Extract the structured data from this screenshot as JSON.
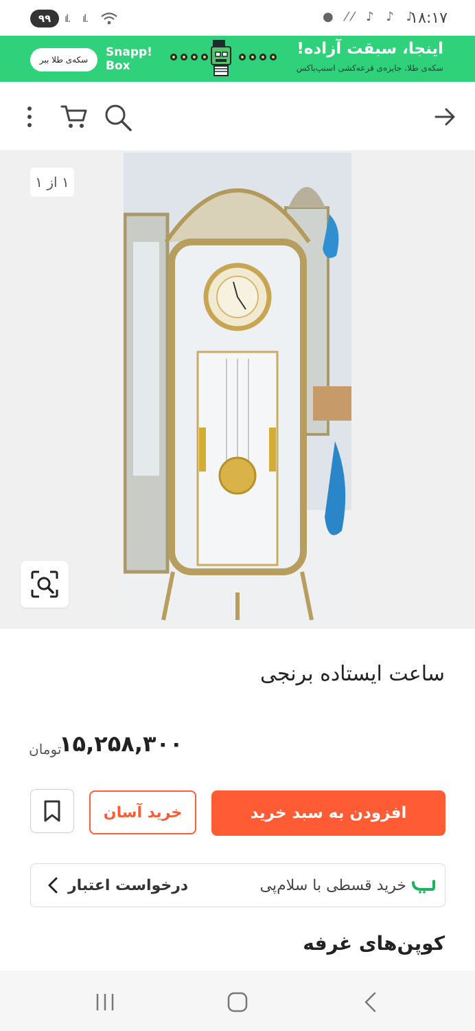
{
  "status_bar": {
    "battery": "۹۹",
    "time": "۱۸:۱۷"
  },
  "banner": {
    "button_label": "سکه‌ی طلا ببر",
    "brand_line1": "Snapp!",
    "brand_line2": "Box",
    "title": "اینجا، سبقت آزاده!",
    "subtitle": "سکه‌ی طلا، جایزه‌ی قرعه‌کشی اسنپ‌باکس",
    "colors": {
      "background": "#2fd17b"
    }
  },
  "app_bar": {
    "icons": [
      "more-vertical-icon",
      "cart-icon",
      "search-icon",
      "arrow-right-icon"
    ]
  },
  "gallery": {
    "counter": "۱ از ۱"
  },
  "product": {
    "title": "ساعت ایستاده برنجی",
    "price": "۱۵,۲۵۸,۳۰۰",
    "currency": "تومان"
  },
  "actions": {
    "add_to_cart": "افزودن به سبد خرید",
    "easy_buy": "خرید آسان"
  },
  "credit": {
    "installment_text": "خرید قسطی با سلام‌پی",
    "request_label": "درخواست اعتبار"
  },
  "coupons": {
    "title": "کوپن‌های غرفه"
  },
  "colors": {
    "accent": "#ff5c35",
    "banner": "#2fd17b",
    "salampay": "#1bb35c"
  }
}
